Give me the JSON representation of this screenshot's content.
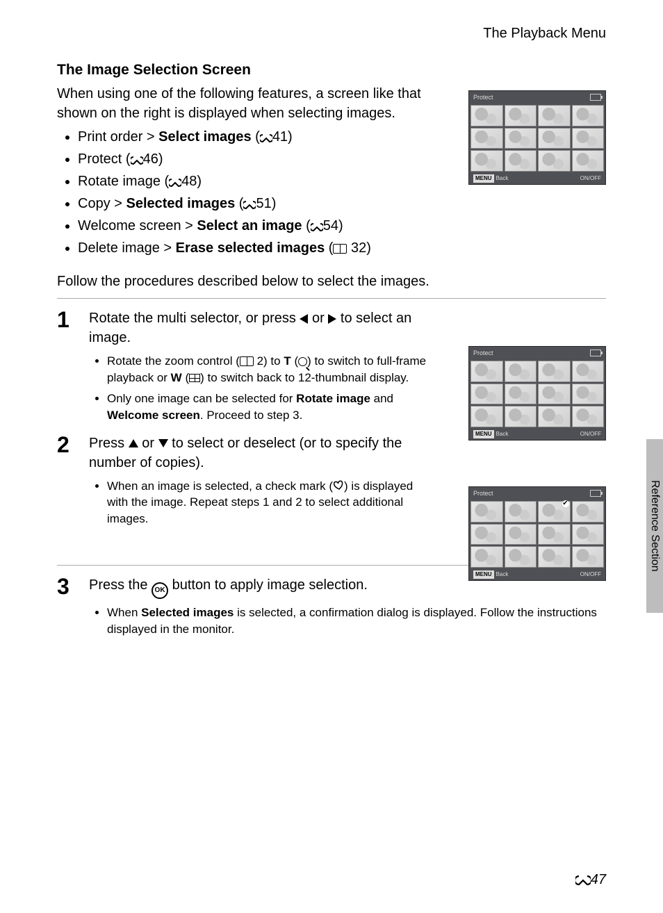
{
  "header": {
    "breadcrumb": "The Playback Menu"
  },
  "section": {
    "title": "The Image Selection Screen",
    "intro": "When using one of the following features, a screen like that shown on the right is displayed when selecting images."
  },
  "features": {
    "print_a": "Print order > ",
    "print_b": "Select images",
    "print_ref": "41)",
    "protect_a": "Protect (",
    "protect_ref": "46)",
    "rotate_a": "Rotate image (",
    "rotate_ref": "48)",
    "copy_a": "Copy > ",
    "copy_b": "Selected images",
    "copy_ref": "51)",
    "welcome_a": "Welcome screen > ",
    "welcome_b": "Select an image",
    "welcome_ref": "54)",
    "delete_a": "Delete image > ",
    "delete_b": "Erase selected images",
    "delete_ref": " 32)"
  },
  "follow": "Follow the procedures described below to select the images.",
  "steps": {
    "s1": {
      "num": "1",
      "title_a": "Rotate the multi selector, or press ",
      "title_b": " or ",
      "title_c": " to select an image.",
      "b1_a": "Rotate the zoom control (",
      "b1_b": " 2) to ",
      "b1_t": "T",
      "b1_c": " (",
      "b1_d": ") to switch to full-frame playback or ",
      "b1_w": "W",
      "b1_e": " (",
      "b1_f": ") to switch back to 12-thumbnail display.",
      "b2_a": "Only one image can be selected for ",
      "b2_b": "Rotate image",
      "b2_c": " and ",
      "b2_d": "Welcome screen",
      "b2_e": ". Proceed to step 3."
    },
    "s2": {
      "num": "2",
      "title_a": "Press ",
      "title_b": " or ",
      "title_c": " to select or deselect (or to specify the number of copies).",
      "b1_a": "When an image is selected, a check mark (",
      "b1_b": ") is displayed with the image. Repeat steps 1 and 2 to select additional images."
    },
    "s3": {
      "num": "3",
      "title_a": "Press the ",
      "title_b": " button to apply image selection.",
      "b1_a": "When ",
      "b1_b": "Selected images",
      "b1_c": " is selected, a confirmation dialog is displayed. Follow the instructions displayed in the monitor."
    }
  },
  "lcd": {
    "title": "Protect",
    "back": "Back",
    "onoff": "ON/OFF",
    "menu": "MENU"
  },
  "side": {
    "label": "Reference Section"
  },
  "pagenum": "47"
}
